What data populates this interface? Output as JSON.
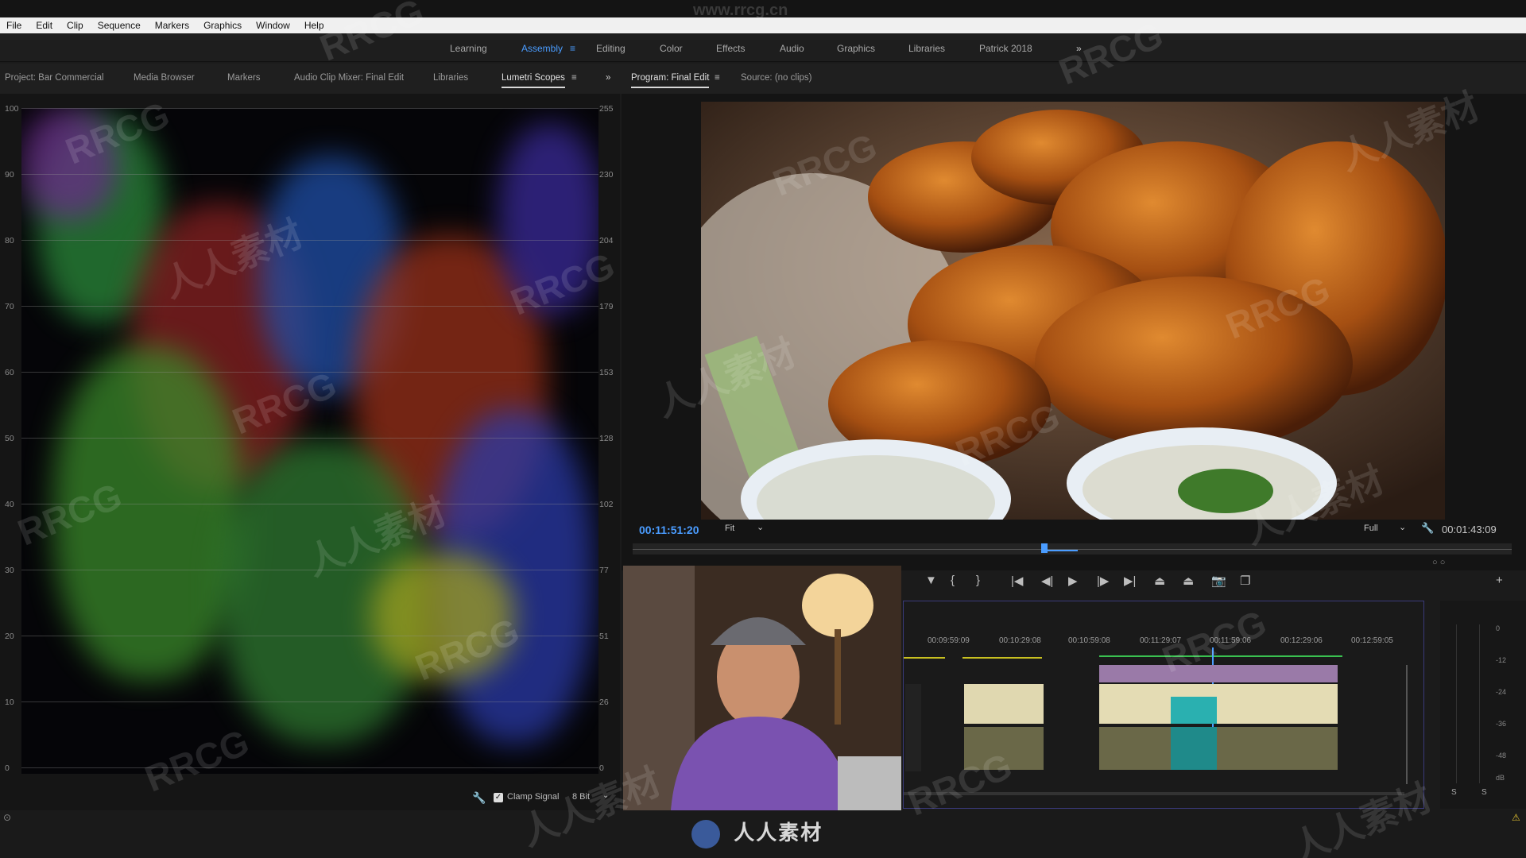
{
  "menubar": {
    "items": [
      "File",
      "Edit",
      "Clip",
      "Sequence",
      "Markers",
      "Graphics",
      "Window",
      "Help"
    ]
  },
  "top_watermark": "www.rrcg.cn",
  "workspaces": {
    "items": [
      "Learning",
      "Assembly",
      "Editing",
      "Color",
      "Effects",
      "Audio",
      "Graphics",
      "Libraries",
      "Patrick 2018"
    ],
    "active": "Assembly",
    "overflow": "»"
  },
  "panel_tabs": {
    "left": [
      "Project: Bar Commercial",
      "Media Browser",
      "Markers",
      "Audio Clip Mixer: Final Edit",
      "Libraries",
      "Lumetri Scopes"
    ],
    "right": [
      "Program: Final Edit",
      "Source: (no clips)"
    ],
    "overflow": "»"
  },
  "scope": {
    "left_scale": [
      "100",
      "90",
      "80",
      "70",
      "60",
      "50",
      "40",
      "30",
      "20",
      "10",
      "0"
    ],
    "right_scale": [
      "255",
      "230",
      "204",
      "179",
      "153",
      "128",
      "102",
      "77",
      "51",
      "26",
      "0"
    ],
    "clamp_label": "Clamp Signal",
    "bit_depth": "8 Bit"
  },
  "program": {
    "current_timecode": "00:11:51:20",
    "zoom": "Fit",
    "quality": "Full",
    "duration": "00:01:43:09"
  },
  "timeline": {
    "ruler": [
      "00:09:59:09",
      "00:10:29:08",
      "00:10:59:08",
      "00:11:29:07",
      "00:11:59:06",
      "00:12:29:06",
      "00:12:59:05"
    ]
  },
  "meters": {
    "scale": [
      "0",
      "-12",
      "-24",
      "-36",
      "-48",
      "dB"
    ],
    "solo": [
      "S",
      "S"
    ]
  },
  "brand_logo": "人人素材",
  "watermarks": [
    "RRCG",
    "人人素材"
  ],
  "colors": {
    "accent": "#4a9cff",
    "timeline_border": "#3a3a7a"
  }
}
